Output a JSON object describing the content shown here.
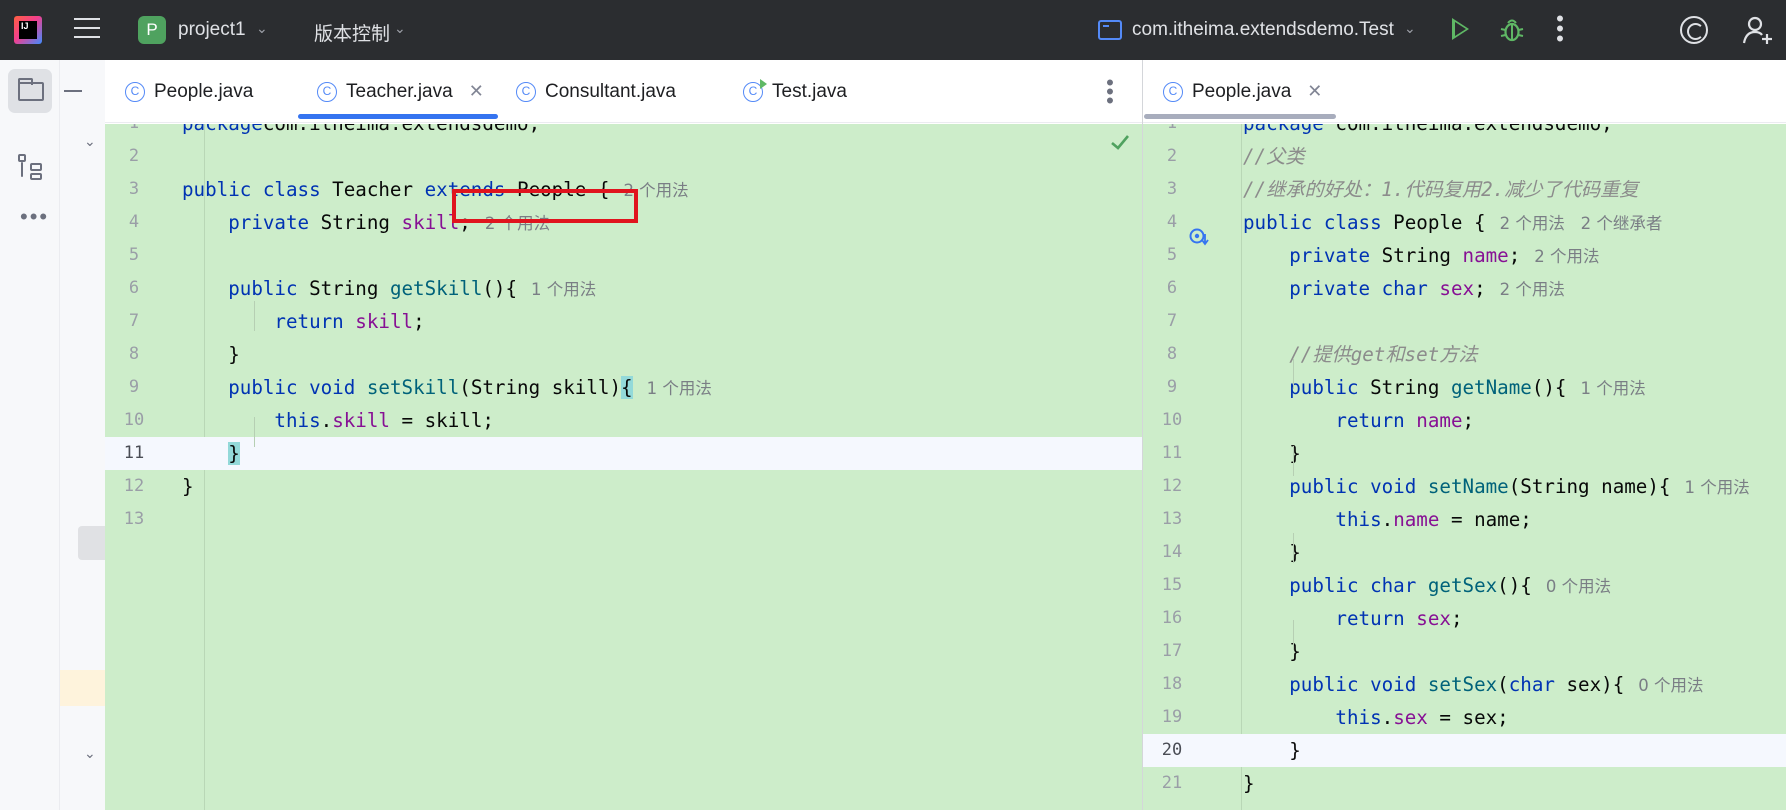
{
  "topbar": {
    "project_badge": "P",
    "project_name": "project1",
    "vcs_label": "版本控制",
    "run_config": "com.itheima.extendsdemo.Test"
  },
  "tabs_left": [
    {
      "label": "People.java"
    },
    {
      "label": "Teacher.java"
    },
    {
      "label": "Consultant.java"
    },
    {
      "label": "Test.java"
    }
  ],
  "tabs_right": [
    {
      "label": "People.java"
    }
  ],
  "icon_glyphs": {
    "class_icon": "C",
    "close": "✕",
    "chevron": "⌄",
    "more": "⋮",
    "more_h": "⋯"
  },
  "editor_left": {
    "file": "Teacher.java",
    "current_line": 11,
    "highlighted_text": "extends People",
    "lines": [
      {
        "n": "1",
        "tokens": [
          [
            "kw",
            "package"
          ],
          [
            "",
            "com.itheima.extendsdemo;"
          ]
        ]
      },
      {
        "n": "2",
        "tokens": []
      },
      {
        "n": "3",
        "tokens": [
          [
            "kw",
            "public class"
          ],
          [
            "",
            " Teacher "
          ],
          [
            "kw",
            "extends"
          ],
          [
            "",
            " People {"
          ]
        ],
        "hint": "2 个用法"
      },
      {
        "n": "4",
        "tokens": [
          [
            "",
            "    "
          ],
          [
            "kw",
            "private"
          ],
          [
            "",
            " String "
          ],
          [
            "fld",
            "skill"
          ],
          [
            "",
            ";"
          ]
        ],
        "hint": "2 个用法"
      },
      {
        "n": "5",
        "tokens": []
      },
      {
        "n": "6",
        "tokens": [
          [
            "",
            "    "
          ],
          [
            "kw",
            "public"
          ],
          [
            "",
            " String "
          ],
          [
            "mth",
            "getSkill"
          ],
          [
            "",
            "(){"
          ]
        ],
        "hint": "1 个用法"
      },
      {
        "n": "7",
        "tokens": [
          [
            "",
            "        "
          ],
          [
            "kw",
            "return"
          ],
          [
            "",
            " "
          ],
          [
            "fld",
            "skill"
          ],
          [
            "",
            ";"
          ]
        ]
      },
      {
        "n": "8",
        "tokens": [
          [
            "",
            "    }"
          ]
        ]
      },
      {
        "n": "9",
        "tokens": [
          [
            "",
            "    "
          ],
          [
            "kw",
            "public void"
          ],
          [
            "",
            " "
          ],
          [
            "mth",
            "setSkill"
          ],
          [
            "",
            "(String skill)"
          ],
          [
            "brace",
            "{"
          ]
        ],
        "hint": "1 个用法"
      },
      {
        "n": "10",
        "tokens": [
          [
            "",
            "        "
          ],
          [
            "kw",
            "this"
          ],
          [
            "",
            "."
          ],
          [
            "fld",
            "skill"
          ],
          [
            "",
            " = skill;"
          ]
        ]
      },
      {
        "n": "11",
        "tokens": [
          [
            "",
            "    "
          ],
          [
            "brace",
            "}"
          ]
        ]
      },
      {
        "n": "12",
        "tokens": [
          [
            "",
            "}"
          ]
        ]
      },
      {
        "n": "13",
        "tokens": []
      }
    ]
  },
  "editor_right": {
    "file": "People.java",
    "current_line": 20,
    "lines": [
      {
        "n": "1",
        "tokens": [
          [
            "kw",
            "package"
          ],
          [
            "",
            " com.itheima.extendsdemo;"
          ]
        ]
      },
      {
        "n": "2",
        "tokens": [
          [
            "cmt",
            "//父类"
          ]
        ]
      },
      {
        "n": "3",
        "tokens": [
          [
            "cmt",
            "//继承的好处：1.代码复用2.减少了代码重复"
          ]
        ]
      },
      {
        "n": "4",
        "tokens": [
          [
            "kw",
            "public class"
          ],
          [
            "",
            " People {"
          ]
        ],
        "hint": "2 个用法   2 个继承者"
      },
      {
        "n": "5",
        "tokens": [
          [
            "",
            "    "
          ],
          [
            "kw",
            "private"
          ],
          [
            "",
            " String "
          ],
          [
            "fld",
            "name"
          ],
          [
            "",
            ";"
          ]
        ],
        "hint": "2 个用法"
      },
      {
        "n": "6",
        "tokens": [
          [
            "",
            "    "
          ],
          [
            "kw",
            "private char"
          ],
          [
            "",
            " "
          ],
          [
            "fld",
            "sex"
          ],
          [
            "",
            ";"
          ]
        ],
        "hint": "2 个用法"
      },
      {
        "n": "7",
        "tokens": []
      },
      {
        "n": "8",
        "tokens": [
          [
            "",
            "    "
          ],
          [
            "cmt",
            "//提供get和set方法"
          ]
        ]
      },
      {
        "n": "9",
        "tokens": [
          [
            "",
            "    "
          ],
          [
            "kw",
            "public"
          ],
          [
            "",
            " String "
          ],
          [
            "mth",
            "getName"
          ],
          [
            "",
            "(){"
          ]
        ],
        "hint": "1 个用法"
      },
      {
        "n": "10",
        "tokens": [
          [
            "",
            "        "
          ],
          [
            "kw",
            "return"
          ],
          [
            "",
            " "
          ],
          [
            "fld",
            "name"
          ],
          [
            "",
            ";"
          ]
        ]
      },
      {
        "n": "11",
        "tokens": [
          [
            "",
            "    }"
          ]
        ]
      },
      {
        "n": "12",
        "tokens": [
          [
            "",
            "    "
          ],
          [
            "kw",
            "public void"
          ],
          [
            "",
            " "
          ],
          [
            "mth",
            "setName"
          ],
          [
            "",
            "(String name){"
          ]
        ],
        "hint": "1 个用法"
      },
      {
        "n": "13",
        "tokens": [
          [
            "",
            "        "
          ],
          [
            "kw",
            "this"
          ],
          [
            "",
            "."
          ],
          [
            "fld",
            "name"
          ],
          [
            "",
            " = name;"
          ]
        ]
      },
      {
        "n": "14",
        "tokens": [
          [
            "",
            "    }"
          ]
        ]
      },
      {
        "n": "15",
        "tokens": [
          [
            "",
            "    "
          ],
          [
            "kw",
            "public char"
          ],
          [
            "",
            " "
          ],
          [
            "mth",
            "getSex"
          ],
          [
            "",
            "(){"
          ]
        ],
        "hint": "0 个用法"
      },
      {
        "n": "16",
        "tokens": [
          [
            "",
            "        "
          ],
          [
            "kw",
            "return"
          ],
          [
            "",
            " "
          ],
          [
            "fld",
            "sex"
          ],
          [
            "",
            ";"
          ]
        ]
      },
      {
        "n": "17",
        "tokens": [
          [
            "",
            "    }"
          ]
        ]
      },
      {
        "n": "18",
        "tokens": [
          [
            "",
            "    "
          ],
          [
            "kw",
            "public void"
          ],
          [
            "",
            " "
          ],
          [
            "mth",
            "setSex"
          ],
          [
            "",
            "("
          ],
          [
            "kw",
            "char"
          ],
          [
            "",
            " sex){"
          ]
        ],
        "hint": "0 个用法"
      },
      {
        "n": "19",
        "tokens": [
          [
            "",
            "        "
          ],
          [
            "kw",
            "this"
          ],
          [
            "",
            "."
          ],
          [
            "fld",
            "sex"
          ],
          [
            "",
            " = sex;"
          ]
        ]
      },
      {
        "n": "20",
        "tokens": [
          [
            "",
            "    }"
          ]
        ]
      },
      {
        "n": "21",
        "tokens": [
          [
            "",
            "}"
          ]
        ]
      }
    ]
  },
  "colors": {
    "editor_bg": "#cdedca",
    "keyword": "#0033b3",
    "field": "#871094",
    "method": "#00627a",
    "highlight_box": "#e0141e",
    "active_tab": "#3574f0"
  }
}
